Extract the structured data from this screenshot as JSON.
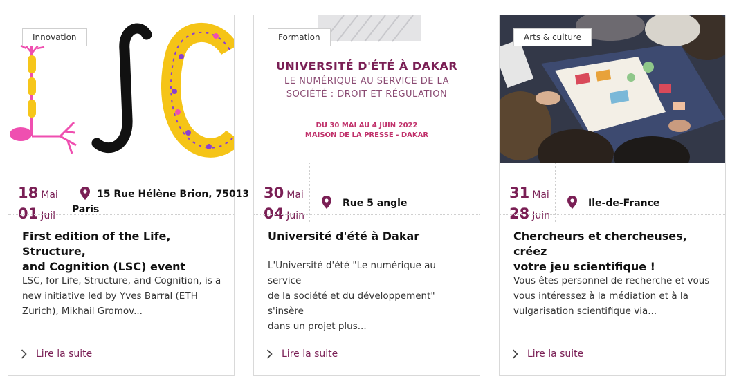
{
  "cards": [
    {
      "tag": "Innovation",
      "image_text": "LSC",
      "start_day": "18",
      "start_month": "Mai",
      "end_day": "01",
      "end_month": "Juil",
      "location_line1": "15 Rue Hélène Brion, 75013",
      "location_line2": "Paris",
      "title_line1": "First edition of the Life, Structure,",
      "title_line2": "and Cognition (LSC) event",
      "desc_line1": "LSC, for Life, Structure, and Cognition, is a",
      "desc_line2": "new initiative led by Yves Barral (ETH",
      "desc_line3": "Zurich), Mikhail Gromov...",
      "more": "Lire la suite"
    },
    {
      "tag": "Formation",
      "poster_title": "UNIVERSITÉ D'ÉTÉ À DAKAR",
      "poster_sub1": "LE NUMÉRIQUE AU SERVICE DE LA",
      "poster_sub2": "SOCIÉTÉ : DROIT ET RÉGULATION",
      "poster_dates": "DU 30 MAI AU 4 JUIN 2022",
      "poster_place": "MAISON DE LA PRESSE - DAKAR",
      "start_day": "30",
      "start_month": "Mai",
      "end_day": "04",
      "end_month": "Juin",
      "location_line1": "Rue 5 angle",
      "title_line1": "Université d'été à Dakar",
      "desc_line1": "L'Université d'été \"Le numérique au service",
      "desc_line2": "de la société et du développement\" s'insère",
      "desc_line3": "dans un projet plus...",
      "more": "Lire la suite"
    },
    {
      "tag": "Arts & culture",
      "start_day": "31",
      "start_month": "Mai",
      "end_day": "28",
      "end_month": "Juin",
      "location_line1": "Ile-de-France",
      "title_line1": "Chercheurs et chercheuses, créez",
      "title_line2": "votre jeu scientifique !",
      "desc_line1": "Vous êtes personnel de recherche et vous",
      "desc_line2": "vous intéressez à la médiation et à la",
      "desc_line3": "vulgarisation scientifique via...",
      "more": "Lire la suite"
    }
  ],
  "colors": {
    "accent": "#7a1f55",
    "border": "#d9d9d9"
  },
  "icons": {
    "location": "map-pin-icon",
    "more": "chevron-right-icon"
  }
}
